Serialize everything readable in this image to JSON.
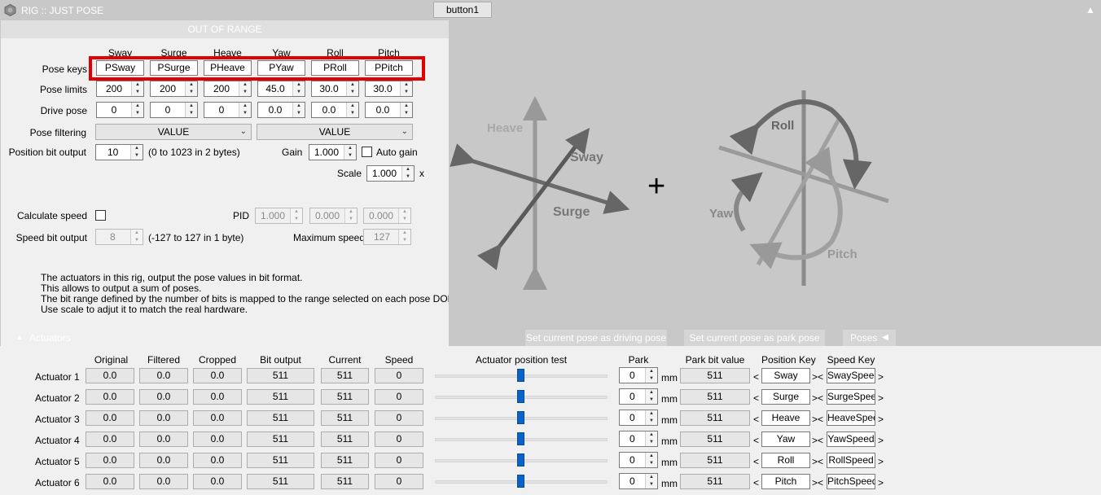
{
  "window": {
    "title": "RIG :: JUST POSE",
    "top_button": "button1",
    "scroll_glyph": "▲"
  },
  "pose_panel": {
    "header": "OUT OF RANGE",
    "dof_headers": [
      "Sway",
      "Surge",
      "Heave",
      "Yaw",
      "Roll",
      "Pitch"
    ],
    "pose_keys_label": "Pose keys",
    "pose_keys": [
      "PSway",
      "PSurge",
      "PHeave",
      "PYaw",
      "PRoll",
      "PPitch"
    ],
    "pose_limits_label": "Pose limits",
    "pose_limits": [
      "200",
      "200",
      "200",
      "45.0",
      "30.0",
      "30.0"
    ],
    "drive_pose_label": "Drive pose",
    "drive_pose": [
      "0",
      "0",
      "0",
      "0.0",
      "0.0",
      "0.0"
    ],
    "pose_filtering_label": "Pose filtering",
    "filter_translation": "VALUE",
    "filter_rotation": "VALUE",
    "position_bit_output_label": "Position bit output",
    "position_bit_output": "10",
    "position_bit_range": "(0 to 1023 in 2 bytes)",
    "gain_label": "Gain",
    "gain": "1.000",
    "auto_gain_label": "Auto gain",
    "scale_label": "Scale",
    "scale": "1.000",
    "scale_unit": "x",
    "calculate_speed_label": "Calculate speed",
    "pid_label": "PID",
    "pid": [
      "1.000",
      "0.000",
      "0.000"
    ],
    "speed_bit_output_label": "Speed bit output",
    "speed_bit_output": "8",
    "speed_bit_range": "(-127 to 127 in 1 byte)",
    "maximum_speed_label": "Maximum speed",
    "maximum_speed": "127",
    "description": [
      "The actuators in this rig, output the pose values in bit format.",
      "This allows to output a sum of poses.",
      "The bit range defined by the number of bits is mapped to the range selected on each pose DOF.",
      "Use scale to adjut it to match the real hardware."
    ]
  },
  "diagram": {
    "heave": "Heave",
    "sway": "Sway",
    "surge": "Surge",
    "plus": "+",
    "roll": "Roll",
    "yaw": "Yaw",
    "pitch": "Pitch"
  },
  "bar": {
    "actuators_tab": "Actuators",
    "set_driving": "Set current pose as driving pose",
    "set_park": "Set current pose as park pose",
    "poses_tab": "Poses"
  },
  "actuators": {
    "headers": {
      "original": "Original",
      "filtered": "Filtered",
      "cropped": "Cropped",
      "bit_output": "Bit output",
      "current": "Current",
      "speed": "Speed",
      "position_test": "Actuator position test",
      "park": "Park",
      "park_bit_value": "Park bit value",
      "position_key": "Position Key",
      "speed_key": "Speed Key"
    },
    "park_unit": "mm",
    "rows": [
      {
        "name": "Actuator 1",
        "original": "0.0",
        "filtered": "0.0",
        "cropped": "0.0",
        "bit_output": "511",
        "current": "511",
        "speed": "0",
        "test_position": 0.5,
        "park": "0",
        "park_bit": "511",
        "position_key": "Sway",
        "speed_key": "SwaySpeed"
      },
      {
        "name": "Actuator 2",
        "original": "0.0",
        "filtered": "0.0",
        "cropped": "0.0",
        "bit_output": "511",
        "current": "511",
        "speed": "0",
        "test_position": 0.5,
        "park": "0",
        "park_bit": "511",
        "position_key": "Surge",
        "speed_key": "SurgeSpeed"
      },
      {
        "name": "Actuator 3",
        "original": "0.0",
        "filtered": "0.0",
        "cropped": "0.0",
        "bit_output": "511",
        "current": "511",
        "speed": "0",
        "test_position": 0.5,
        "park": "0",
        "park_bit": "511",
        "position_key": "Heave",
        "speed_key": "HeaveSpeed"
      },
      {
        "name": "Actuator 4",
        "original": "0.0",
        "filtered": "0.0",
        "cropped": "0.0",
        "bit_output": "511",
        "current": "511",
        "speed": "0",
        "test_position": 0.5,
        "park": "0",
        "park_bit": "511",
        "position_key": "Yaw",
        "speed_key": "YawSpeed"
      },
      {
        "name": "Actuator 5",
        "original": "0.0",
        "filtered": "0.0",
        "cropped": "0.0",
        "bit_output": "511",
        "current": "511",
        "speed": "0",
        "test_position": 0.5,
        "park": "0",
        "park_bit": "511",
        "position_key": "Roll",
        "speed_key": "RollSpeed"
      },
      {
        "name": "Actuator 6",
        "original": "0.0",
        "filtered": "0.0",
        "cropped": "0.0",
        "bit_output": "511",
        "current": "511",
        "speed": "0",
        "test_position": 0.5,
        "park": "0",
        "park_bit": "511",
        "position_key": "Pitch",
        "speed_key": "PitchSpeed"
      }
    ]
  }
}
